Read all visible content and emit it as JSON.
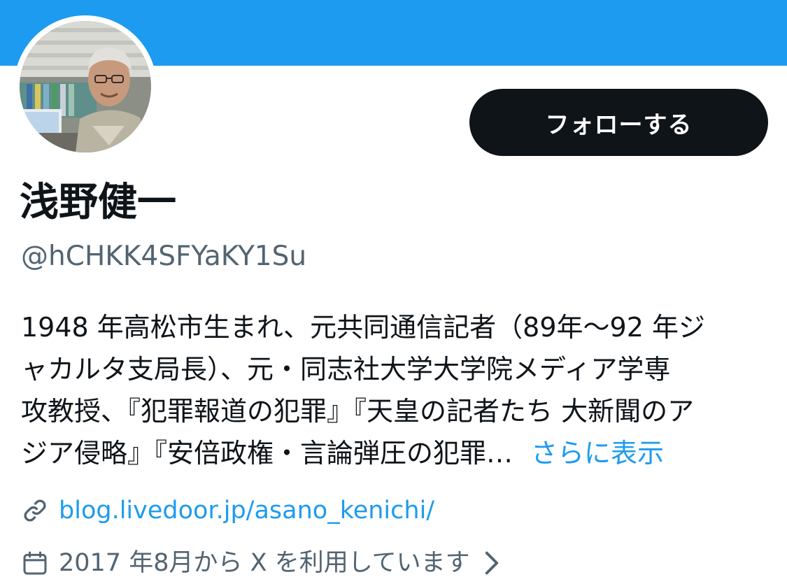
{
  "colors": {
    "banner": "#1d9bf0",
    "accent": "#1d9bf0",
    "text_primary": "#0f1419",
    "text_secondary": "#536471",
    "button_bg": "#0f1419",
    "button_text": "#ffffff"
  },
  "profile": {
    "display_name": "浅野健一",
    "handle": "@hCHKK4SFYaKY1Su",
    "follow_label": "フォローする",
    "bio_lines": [
      "1948 年高松市生まれ、元共同通信記者（89年〜92 年ジ",
      "ャカルタ支局長）、元・同志社大学大学院メディア学専",
      "攻教授、『犯罪報道の犯罪』『天皇の記者たち 大新聞のア",
      "ジア侵略』『安倍政権・言論弾圧の犯罪…"
    ],
    "bio_more": "さらに表示",
    "link": "blog.livedoor.jp/asano_kenichi/",
    "joined": "2017 年8月から X を利用しています"
  },
  "icons": {
    "avatar": "avatar-photo",
    "link": "link-icon",
    "calendar": "calendar-icon",
    "chevron": "chevron-right-icon"
  }
}
